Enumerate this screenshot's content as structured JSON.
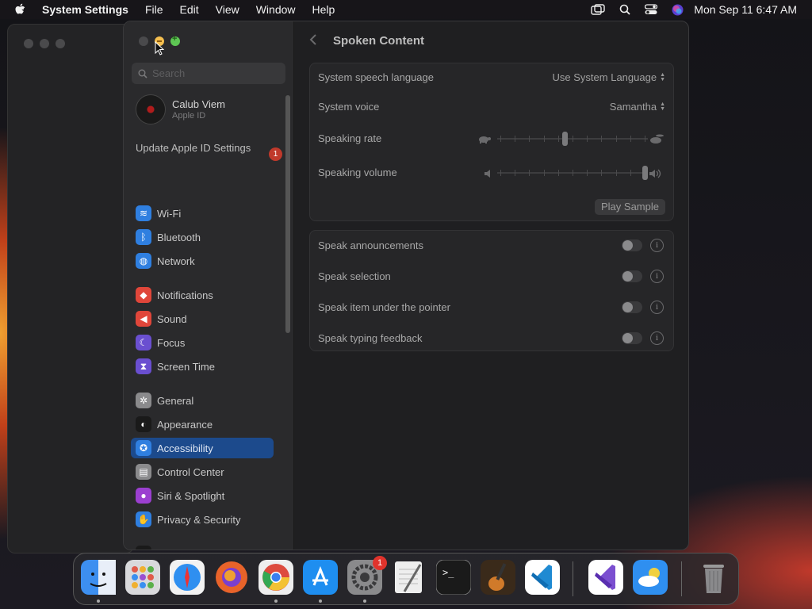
{
  "menubar": {
    "app_name": "System Settings",
    "menus": [
      "File",
      "Edit",
      "View",
      "Window",
      "Help"
    ],
    "clock": "Mon Sep 11  6:47 AM"
  },
  "search": {
    "placeholder": "Search"
  },
  "account": {
    "name": "Calub Viem",
    "subtitle": "Apple ID"
  },
  "update": {
    "label": "Update Apple ID Settings",
    "badge": "1"
  },
  "sidebar": {
    "items": [
      {
        "label": "Wi-Fi",
        "icon": "wifi-icon",
        "color": "#2f7fe0"
      },
      {
        "label": "Bluetooth",
        "icon": "bluetooth-icon",
        "color": "#2f7fe0"
      },
      {
        "label": "Network",
        "icon": "globe-icon",
        "color": "#2f7fe0"
      },
      {
        "label": "Notifications",
        "icon": "bell-icon",
        "color": "#e0463a"
      },
      {
        "label": "Sound",
        "icon": "speaker-icon",
        "color": "#e0463a"
      },
      {
        "label": "Focus",
        "icon": "moon-icon",
        "color": "#6a4fd0"
      },
      {
        "label": "Screen Time",
        "icon": "hourglass-icon",
        "color": "#6a4fd0"
      },
      {
        "label": "General",
        "icon": "gear-icon",
        "color": "#8a8a8c"
      },
      {
        "label": "Appearance",
        "icon": "appearance-icon",
        "color": "#1a1a1a"
      },
      {
        "label": "Accessibility",
        "icon": "accessibility-icon",
        "color": "#2f7fe0"
      },
      {
        "label": "Control Center",
        "icon": "control-center-icon",
        "color": "#8a8a8c"
      },
      {
        "label": "Siri & Spotlight",
        "icon": "siri-icon",
        "color": "#9b3fd0"
      },
      {
        "label": "Privacy & Security",
        "icon": "hand-icon",
        "color": "#2f7fe0"
      },
      {
        "label": "Desktop & Dock",
        "icon": "dock-icon",
        "color": "#1a1a1a"
      }
    ],
    "selected": "Accessibility"
  },
  "content": {
    "title": "Spoken Content",
    "speech_language": {
      "label": "System speech language",
      "value": "Use System Language"
    },
    "voice": {
      "label": "System voice",
      "value": "Samantha"
    },
    "rate": {
      "label": "Speaking rate",
      "level": 0.45
    },
    "volume": {
      "label": "Speaking volume",
      "level": 1.0
    },
    "play_sample": "Play Sample",
    "toggles": [
      {
        "label": "Speak announcements",
        "on": false
      },
      {
        "label": "Speak selection",
        "on": false
      },
      {
        "label": "Speak item under the pointer",
        "on": false
      },
      {
        "label": "Speak typing feedback",
        "on": false
      }
    ],
    "help": "?"
  },
  "dock": {
    "apps": [
      {
        "name": "Finder",
        "icon": "finder-icon",
        "color": "#3d8ff0",
        "running": true
      },
      {
        "name": "Launchpad",
        "icon": "launchpad-icon",
        "color": "#d9d9dc",
        "running": false
      },
      {
        "name": "Safari",
        "icon": "safari-icon",
        "color": "#2f8ff0",
        "running": false
      },
      {
        "name": "Firefox",
        "icon": "firefox-icon",
        "color": "#e8632a",
        "running": false
      },
      {
        "name": "Chrome",
        "icon": "chrome-icon",
        "color": "#eeeeee",
        "running": true
      },
      {
        "name": "App Store",
        "icon": "app-store-icon",
        "color": "#1e8ef0",
        "running": true
      },
      {
        "name": "System Settings",
        "icon": "system-settings-icon",
        "color": "#8a8a8c",
        "running": true,
        "badge": "1"
      },
      {
        "name": "TextEdit",
        "icon": "textedit-icon",
        "color": "#eeeeee",
        "running": false
      },
      {
        "name": "Terminal",
        "icon": "terminal-icon",
        "color": "#1a1a1a",
        "running": false
      },
      {
        "name": "GarageBand",
        "icon": "garageband-icon",
        "color": "#3a2a1a",
        "running": false
      },
      {
        "name": "Visual Studio Code",
        "icon": "vscode-icon",
        "color": "#ffffff",
        "running": false
      },
      {
        "name": "Visual Studio",
        "icon": "visual-studio-icon",
        "color": "#ffffff",
        "running": false
      },
      {
        "name": "Weather",
        "icon": "weather-icon",
        "color": "#2f8ff0",
        "running": false
      },
      {
        "name": "Trash",
        "icon": "trash-icon",
        "color": "#8a8a8c",
        "running": false
      }
    ]
  }
}
